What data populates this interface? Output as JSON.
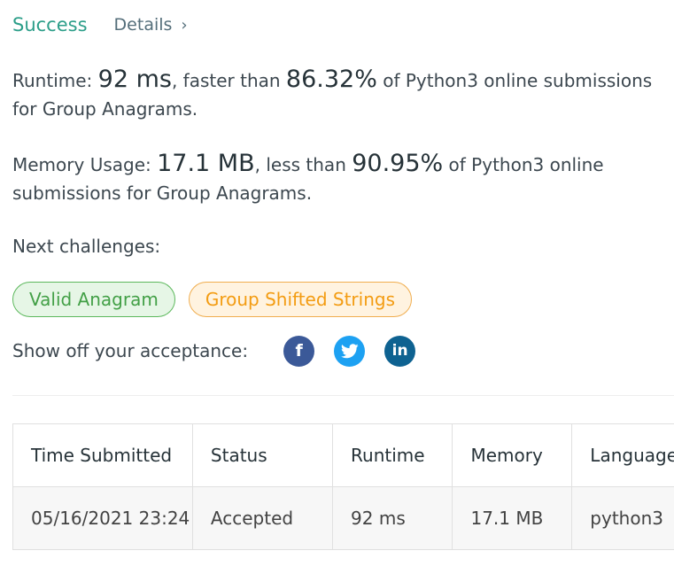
{
  "header": {
    "status": "Success",
    "details_label": "Details",
    "details_chevron": "›"
  },
  "runtime": {
    "label": "Runtime: ",
    "value": "92 ms",
    "comparison": ", faster than ",
    "percent": "86.32%",
    "suffix": " of Python3 online submissions for Group Anagrams."
  },
  "memory": {
    "label": "Memory Usage: ",
    "value": "17.1 MB",
    "comparison": ", less than ",
    "percent": "90.95%",
    "suffix": " of Python3 online submissions for Group Anagrams."
  },
  "next_challenges": {
    "label": "Next challenges:",
    "items": [
      {
        "label": "Valid Anagram",
        "difficulty": "easy",
        "color": "#43a047"
      },
      {
        "label": "Group Shifted Strings",
        "difficulty": "medium",
        "color": "#f39c12"
      }
    ]
  },
  "share": {
    "label": "Show off your acceptance:",
    "icons": [
      {
        "name": "facebook-icon",
        "glyph": "f",
        "color": "#3b5998"
      },
      {
        "name": "twitter-icon",
        "glyph": "",
        "color": "#1da1f2"
      },
      {
        "name": "linkedin-icon",
        "glyph": "in",
        "color": "#0e6291"
      }
    ]
  },
  "table": {
    "headers": [
      "Time Submitted",
      "Status",
      "Runtime",
      "Memory",
      "Language"
    ],
    "rows": [
      {
        "time": "05/16/2021 23:24",
        "status": "Accepted",
        "runtime": "92 ms",
        "memory": "17.1 MB",
        "language": "python3"
      }
    ]
  },
  "colors": {
    "success": "#2c9e89",
    "easy": "#43a047",
    "medium": "#f39c12"
  }
}
